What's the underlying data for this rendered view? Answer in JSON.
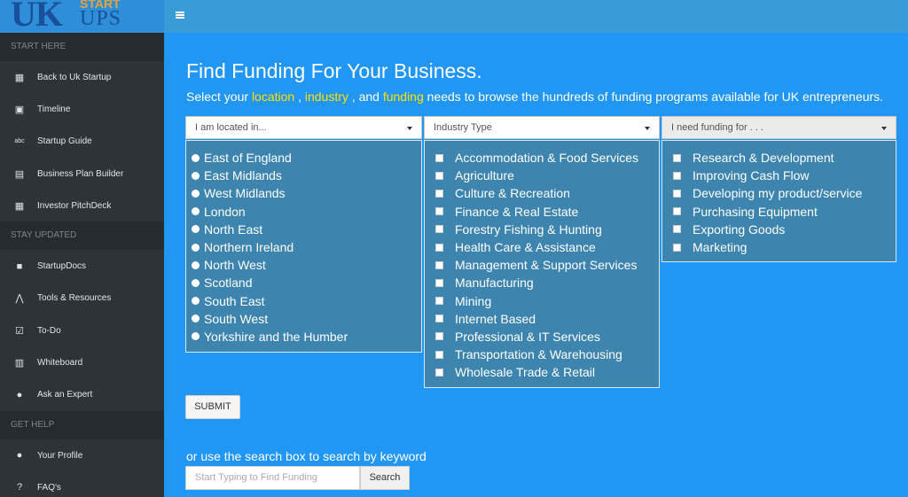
{
  "brand": {
    "logo_primary": "UK",
    "logo_top": "START",
    "logo_bottom": "UPS"
  },
  "sidebar": {
    "sections": [
      {
        "heading": "START HERE",
        "items": [
          {
            "label": "Back to Uk Startup",
            "icon": "grid-icon"
          },
          {
            "label": "Timeline",
            "icon": "calendar-icon"
          },
          {
            "label": "Startup Guide",
            "icon": "abc-icon"
          },
          {
            "label": "Business Plan Builder",
            "icon": "clipboard-icon"
          },
          {
            "label": "Investor PitchDeck",
            "icon": "calendar-grid-icon"
          }
        ]
      },
      {
        "heading": "STAY UPDATED",
        "items": [
          {
            "label": "StartupDocs",
            "icon": "briefcase-icon"
          },
          {
            "label": "Tools & Resources",
            "icon": "tools-icon"
          },
          {
            "label": "To-Do",
            "icon": "checkbox-icon"
          },
          {
            "label": "Whiteboard",
            "icon": "board-icon"
          },
          {
            "label": "Ask an Expert",
            "icon": "person-icon"
          }
        ]
      },
      {
        "heading": "GET HELP",
        "items": [
          {
            "label": "Your Profile",
            "icon": "user-icon"
          },
          {
            "label": "FAQ's",
            "icon": "question-icon"
          }
        ]
      }
    ]
  },
  "main": {
    "title": "Find Funding For Your Business.",
    "subtitle_parts": [
      {
        "text": "Select your ",
        "highlight": false
      },
      {
        "text": "location",
        "highlight": true
      },
      {
        "text": " , ",
        "highlight": false
      },
      {
        "text": "industry",
        "highlight": true
      },
      {
        "text": " , and ",
        "highlight": false
      },
      {
        "text": "funding",
        "highlight": true
      },
      {
        "text": " needs to browse the hundreds of funding programs available for UK entrepreneurs.",
        "highlight": false
      }
    ],
    "location": {
      "placeholder": "I am located in...",
      "options": [
        "East of England",
        "East Midlands",
        "West Midlands",
        "London",
        "North East",
        "Northern Ireland",
        "North West",
        "Scotland",
        "South East",
        "South West",
        "Yorkshire and the Humber"
      ]
    },
    "industry": {
      "placeholder": "Industry Type",
      "options": [
        "Accommodation & Food Services",
        "Agriculture",
        "Culture & Recreation",
        "Finance & Real Estate",
        "Forestry Fishing & Hunting",
        "Health Care & Assistance",
        "Management & Support Services",
        "Manufacturing",
        "Mining",
        "Internet Based",
        "Professional & IT Services",
        "Transportation & Warehousing",
        "Wholesale Trade & Retail"
      ]
    },
    "funding": {
      "placeholder": "I need funding for . . .",
      "options": [
        "Research & Development",
        "Improving Cash Flow",
        "Developing my product/service",
        "Purchasing Equipment",
        "Exporting Goods",
        "Marketing"
      ]
    },
    "submit_label": "SUBMIT",
    "search_prompt": "or use the search box to search by keyword",
    "search_placeholder": "Start Typing to Find Funding",
    "search_button": "Search"
  }
}
